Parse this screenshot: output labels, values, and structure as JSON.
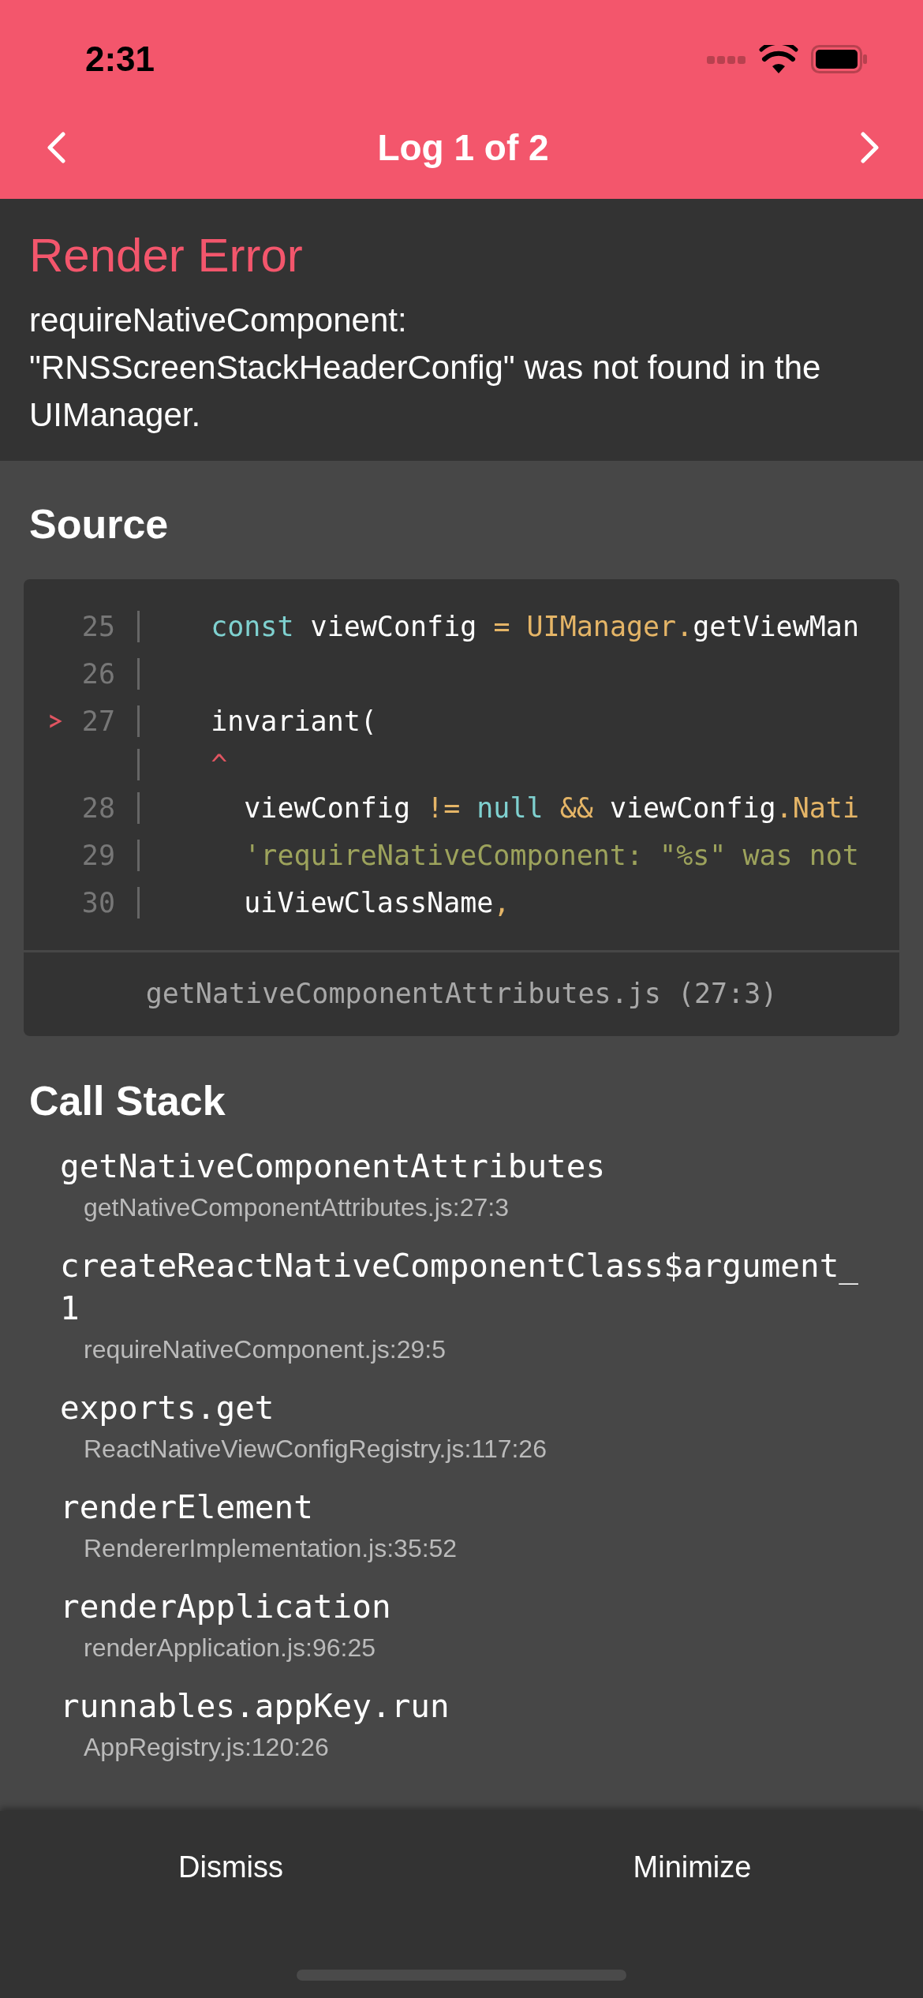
{
  "status_bar": {
    "time": "2:31"
  },
  "nav": {
    "title": "Log 1 of 2"
  },
  "error": {
    "title": "Render Error",
    "message": "requireNativeComponent: \"RNSScreenStackHeaderConfig\" was not found in the UIManager."
  },
  "source": {
    "heading": "Source",
    "lines": [
      {
        "number": "25",
        "current": false,
        "tokens": [
          {
            "text": "  const",
            "kind": "keyword"
          },
          {
            "text": " viewConfig ",
            "kind": "plain"
          },
          {
            "text": "= UIManager.",
            "kind": "operator"
          },
          {
            "text": "getViewMan",
            "kind": "plain"
          }
        ]
      },
      {
        "number": "26",
        "current": false
      },
      {
        "number": "27",
        "current": true,
        "tokens": [
          {
            "text": "  invariant(",
            "kind": "plain"
          }
        ]
      },
      {
        "current": false,
        "tokens": [
          {
            "text": "  ^",
            "kind": "caret"
          }
        ]
      },
      {
        "number": "28",
        "current": false,
        "tokens": [
          {
            "text": "    viewConfig ",
            "kind": "plain"
          },
          {
            "text": "!= ",
            "kind": "operator"
          },
          {
            "text": "null ",
            "kind": "keyword"
          },
          {
            "text": "&&",
            "kind": "operator"
          },
          {
            "text": " viewConfig",
            "kind": "plain"
          },
          {
            "text": ".Nati",
            "kind": "operator"
          }
        ]
      },
      {
        "number": "29",
        "current": false,
        "tokens": [
          {
            "text": "    'requireNativeComponent: \"%s\" was not",
            "kind": "string"
          }
        ]
      },
      {
        "number": "30",
        "current": false,
        "tokens": [
          {
            "text": "    uiViewClassName",
            "kind": "plain"
          },
          {
            "text": ",",
            "kind": "operator"
          }
        ]
      }
    ],
    "location": "getNativeComponentAttributes.js (27:3)"
  },
  "call_stack": {
    "heading": "Call Stack",
    "frames": [
      {
        "name": "getNativeComponentAttributes",
        "file": "getNativeComponentAttributes.js:27:3"
      },
      {
        "name": "createReactNativeComponentClass$argument_1",
        "file": "requireNativeComponent.js:29:5"
      },
      {
        "name": "exports.get",
        "file": "ReactNativeViewConfigRegistry.js:117:26"
      },
      {
        "name": "renderElement",
        "file": "RendererImplementation.js:35:52"
      },
      {
        "name": "renderApplication",
        "file": "renderApplication.js:96:25"
      },
      {
        "name": "runnables.appKey.run",
        "file": "AppRegistry.js:120:26"
      }
    ]
  },
  "footer": {
    "buttons": [
      "Dismiss",
      "Minimize"
    ]
  }
}
